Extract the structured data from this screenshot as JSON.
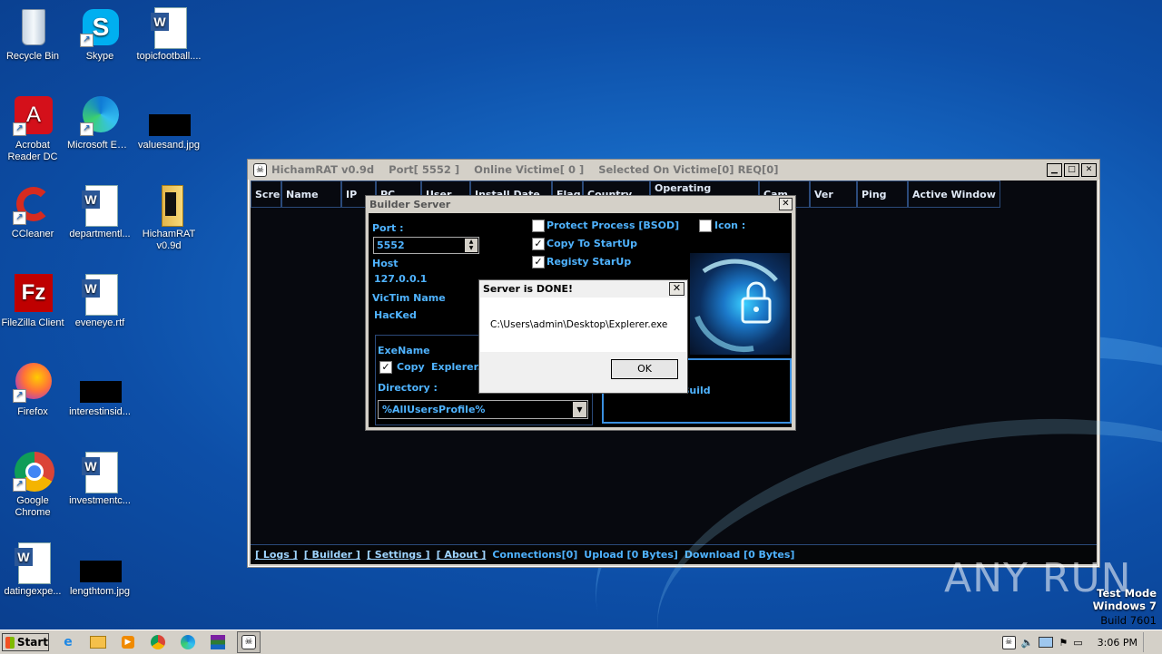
{
  "desktop": {
    "icons": [
      {
        "label": "Recycle Bin",
        "icon": "recycle-bin-icon"
      },
      {
        "label": "Skype",
        "icon": "skype-icon"
      },
      {
        "label": "topicfootball....",
        "icon": "word-doc-icon"
      },
      {
        "label": "Acrobat Reader DC",
        "icon": "acrobat-icon"
      },
      {
        "label": "Microsoft Edge",
        "icon": "edge-icon"
      },
      {
        "label": "valuesand.jpg",
        "icon": "image-thumb-icon"
      },
      {
        "label": "CCleaner",
        "icon": "ccleaner-icon"
      },
      {
        "label": "departmentl...",
        "icon": "word-doc-icon"
      },
      {
        "label": "HichamRAT v0.9d",
        "icon": "folder-icon"
      },
      {
        "label": "FileZilla Client",
        "icon": "filezilla-icon"
      },
      {
        "label": "eveneye.rtf",
        "icon": "word-doc-icon"
      },
      {
        "label": "Firefox",
        "icon": "firefox-icon"
      },
      {
        "label": "interestinsid...",
        "icon": "image-thumb-icon"
      },
      {
        "label": "Google Chrome",
        "icon": "chrome-icon"
      },
      {
        "label": "investmentc...",
        "icon": "word-doc-icon"
      },
      {
        "label": "datingexpe...",
        "icon": "word-doc-icon"
      },
      {
        "label": "lengthtom.jpg",
        "icon": "image-thumb-icon"
      }
    ]
  },
  "main_window": {
    "title": "HichamRAT v0.9d    Port[ 5552 ]    Online Victime[ 0 ]    Selected On Victime[0] REQ[0]",
    "columns": [
      "Scree",
      "Name",
      "IP",
      "PC",
      "User",
      "Install Date",
      "Flag",
      "Country",
      "Operating System",
      "Cam",
      "Ver",
      "Ping",
      "Active Window"
    ],
    "status": {
      "logs": "[ Logs ]",
      "builder": "[ Builder ]",
      "settings": "[ Settings ]",
      "about": "[ About ]",
      "connections": "Connections[0]",
      "upload": "Upload [0 Bytes]",
      "download": "Download [0 Bytes]"
    }
  },
  "builder": {
    "title": "Builder Server",
    "port_label": "Port :",
    "port_value": "5552",
    "host_label": "Host",
    "host_value": "127.0.0.1",
    "victim_label": "VicTim Name",
    "victim_value": "HacKed",
    "protect_label": "Protect Process [BSOD]",
    "protect_checked": false,
    "startup_label": "Copy To StartUp",
    "startup_checked": true,
    "registry_label": "Registy StarUp",
    "registry_checked": true,
    "icon_label": "Icon :",
    "icon_checked": false,
    "exename_label": "ExeName",
    "copy_label": "Copy",
    "copy_checked": true,
    "exe_value": "Explerer.e",
    "directory_label": "Directory :",
    "directory_value": "%AllUsersProfile%",
    "build_label": "Build"
  },
  "message": {
    "title": "Server is DONE!",
    "text": "C:\\Users\\admin\\Desktop\\Explerer.exe",
    "ok": "OK"
  },
  "taskbar": {
    "start": "Start",
    "clock": "3:06 PM"
  },
  "watermark": {
    "line1": "Test Mode",
    "line2": "Windows 7",
    "line3": "Build 7601",
    "brand": "ANY RUN"
  }
}
